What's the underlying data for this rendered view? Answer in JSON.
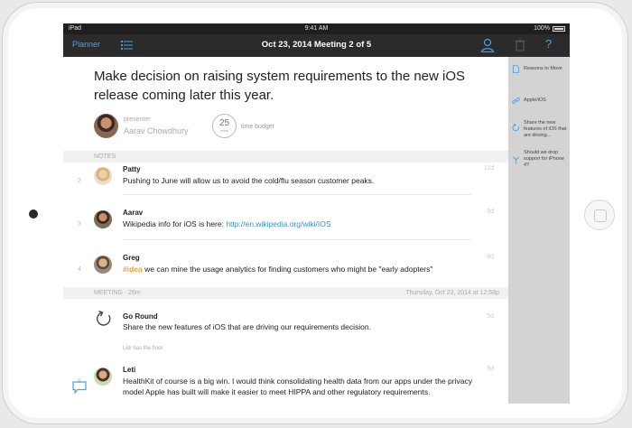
{
  "status_bar": {
    "carrier": "iPad",
    "time": "9:41 AM",
    "battery": "100%"
  },
  "nav": {
    "back_label": "Planner",
    "title": "Oct 23, 2014 Meeting 2 of 5",
    "icons": [
      "list-icon",
      "user-icon",
      "trash-icon",
      "help-icon"
    ],
    "help_glyph": "?",
    "accent_color": "#4aa3df"
  },
  "decision": {
    "title": "Make decision on raising system requirements to the new iOS release coming later this year.",
    "presenter_label": "presenter",
    "presenter_name": "Aarav Chowdhury",
    "time_budget_value": "25",
    "time_budget_unit": "mins",
    "time_budget_label": "time budget"
  },
  "notes_section": {
    "label": "NOTES"
  },
  "notes": [
    {
      "num": "2",
      "name": "Patty",
      "text": "Pushing to June will allow us to avoid the cold/flu season customer peaks.",
      "time": "11d"
    },
    {
      "num": "3",
      "name": "Aarav",
      "text_prefix": "Wikipedia info for iOS is here: ",
      "link": "http://en.wikipedia.org/wiki/IOS",
      "time": "9d"
    },
    {
      "num": "4",
      "name": "Greg",
      "tag": "#idea",
      "text_rest": " we can mine the usage analytics for finding customers who might be \"early adopters\"",
      "time": "8d"
    }
  ],
  "meeting_section": {
    "label": "MEETING",
    "elapsed": "· 26m",
    "date": "Thursday, Oct 23, 2014 at 12:58p"
  },
  "meeting": [
    {
      "name": "Go Round",
      "text": "Share the new features of iOS that are driving our requirements decision.",
      "time": "5d",
      "sub": "Leti has the floor"
    },
    {
      "num": "6",
      "name": "Leti",
      "text": "HealthKit of course is a big win. I would think consolidating health data from our apps under the privacy model Apple has built will make it easier to meet HIPPA and other regulatory requirements.",
      "time": "5d"
    }
  ],
  "sidebar": {
    "items": [
      {
        "icon": "document-icon",
        "label": "Reasons to Move"
      },
      {
        "icon": "link-icon",
        "label": "Apple/iOS"
      },
      {
        "icon": "refresh-icon",
        "label": "Share the new features of iOS that are driving..."
      },
      {
        "icon": "decision-icon",
        "label": "Should we drop support for iPhone 4?"
      }
    ]
  }
}
